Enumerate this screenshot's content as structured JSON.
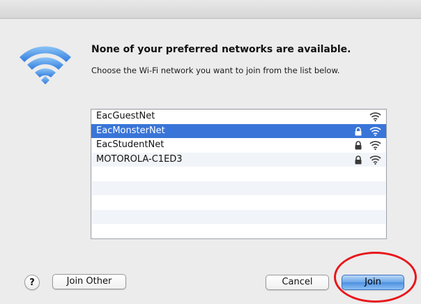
{
  "dialog": {
    "heading": "None of your preferred networks are available.",
    "subheading": "Choose the Wi-Fi network you want to join from the list below."
  },
  "networks": [
    {
      "name": "EacGuestNet",
      "secured": false,
      "selected": false
    },
    {
      "name": "EacMonsterNet",
      "secured": true,
      "selected": true
    },
    {
      "name": "EacStudentNet",
      "secured": true,
      "selected": false
    },
    {
      "name": "MOTOROLA-C1ED3",
      "secured": true,
      "selected": false
    }
  ],
  "buttons": {
    "help": "?",
    "join_other": "Join Other",
    "cancel": "Cancel",
    "join": "Join"
  },
  "icons": {
    "app": "wifi-icon",
    "lock": "lock-icon",
    "signal": "wifi-signal-icon"
  },
  "colors": {
    "selection": "#3975d8",
    "logo_blue": "#3f8ae6",
    "annotation_ring": "#e8161b"
  }
}
